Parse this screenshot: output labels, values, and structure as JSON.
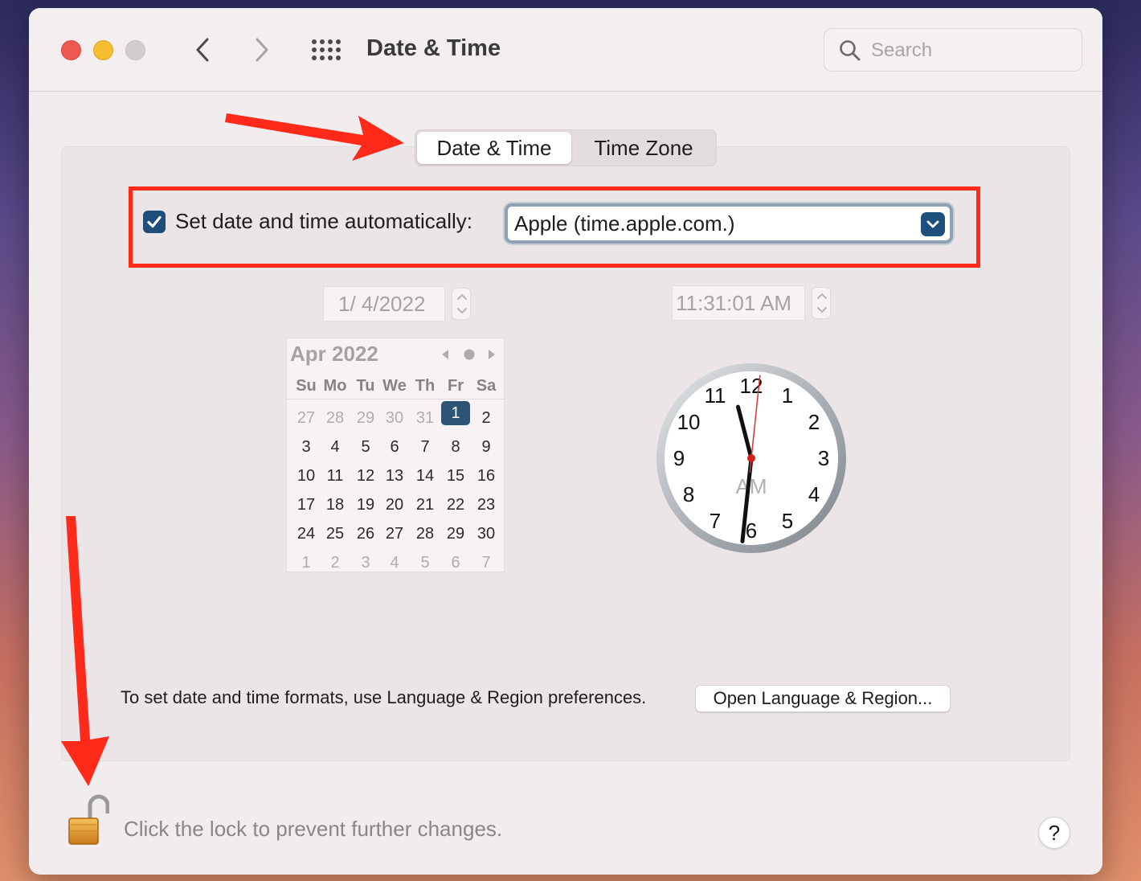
{
  "window": {
    "title": "Date & Time"
  },
  "search": {
    "placeholder": "Search",
    "value": ""
  },
  "tabs": [
    {
      "label": "Date & Time",
      "active": true
    },
    {
      "label": "Time Zone",
      "active": false
    }
  ],
  "auto_time": {
    "checked": true,
    "label": "Set date and time automatically:",
    "server": "Apple (time.apple.com.)"
  },
  "date_field": {
    "value": "1/  4/2022"
  },
  "time_field": {
    "value": "11:31:01 AM"
  },
  "calendar": {
    "title": "Apr 2022",
    "weekdays": [
      "Su",
      "Mo",
      "Tu",
      "We",
      "Th",
      "Fr",
      "Sa"
    ],
    "weeks": [
      [
        {
          "d": "27",
          "m": true
        },
        {
          "d": "28",
          "m": true
        },
        {
          "d": "29",
          "m": true
        },
        {
          "d": "30",
          "m": true
        },
        {
          "d": "31",
          "m": true
        },
        {
          "d": "1",
          "s": true
        },
        {
          "d": "2"
        }
      ],
      [
        {
          "d": "3"
        },
        {
          "d": "4"
        },
        {
          "d": "5"
        },
        {
          "d": "6"
        },
        {
          "d": "7"
        },
        {
          "d": "8"
        },
        {
          "d": "9"
        }
      ],
      [
        {
          "d": "10"
        },
        {
          "d": "11"
        },
        {
          "d": "12"
        },
        {
          "d": "13"
        },
        {
          "d": "14"
        },
        {
          "d": "15"
        },
        {
          "d": "16"
        }
      ],
      [
        {
          "d": "17"
        },
        {
          "d": "18"
        },
        {
          "d": "19"
        },
        {
          "d": "20"
        },
        {
          "d": "21"
        },
        {
          "d": "22"
        },
        {
          "d": "23"
        }
      ],
      [
        {
          "d": "24"
        },
        {
          "d": "25"
        },
        {
          "d": "26"
        },
        {
          "d": "27"
        },
        {
          "d": "28"
        },
        {
          "d": "29"
        },
        {
          "d": "30"
        }
      ],
      [
        {
          "d": "1",
          "m": true
        },
        {
          "d": "2",
          "m": true
        },
        {
          "d": "3",
          "m": true
        },
        {
          "d": "4",
          "m": true
        },
        {
          "d": "5",
          "m": true
        },
        {
          "d": "6",
          "m": true
        },
        {
          "d": "7",
          "m": true
        }
      ]
    ]
  },
  "clock": {
    "numbers": [
      "12",
      "1",
      "2",
      "3",
      "4",
      "5",
      "6",
      "7",
      "8",
      "9",
      "10",
      "11"
    ],
    "ampm": "AM",
    "hour": 11,
    "minute": 31,
    "second": 1
  },
  "formats": {
    "text": "To set date and time formats, use Language & Region preferences.",
    "button": "Open Language & Region..."
  },
  "lock": {
    "text": "Click the lock to prevent further changes."
  },
  "help": {
    "label": "?"
  },
  "colors": {
    "accent": "#1d4f7c",
    "annotation": "#ff2a1a"
  },
  "icons": [
    "close-button",
    "minimize-button",
    "zoom-button",
    "chevron-left-icon",
    "chevron-right-icon",
    "grid-icon",
    "search-icon",
    "checkmark-icon",
    "chevron-down-icon",
    "lock-icon"
  ]
}
